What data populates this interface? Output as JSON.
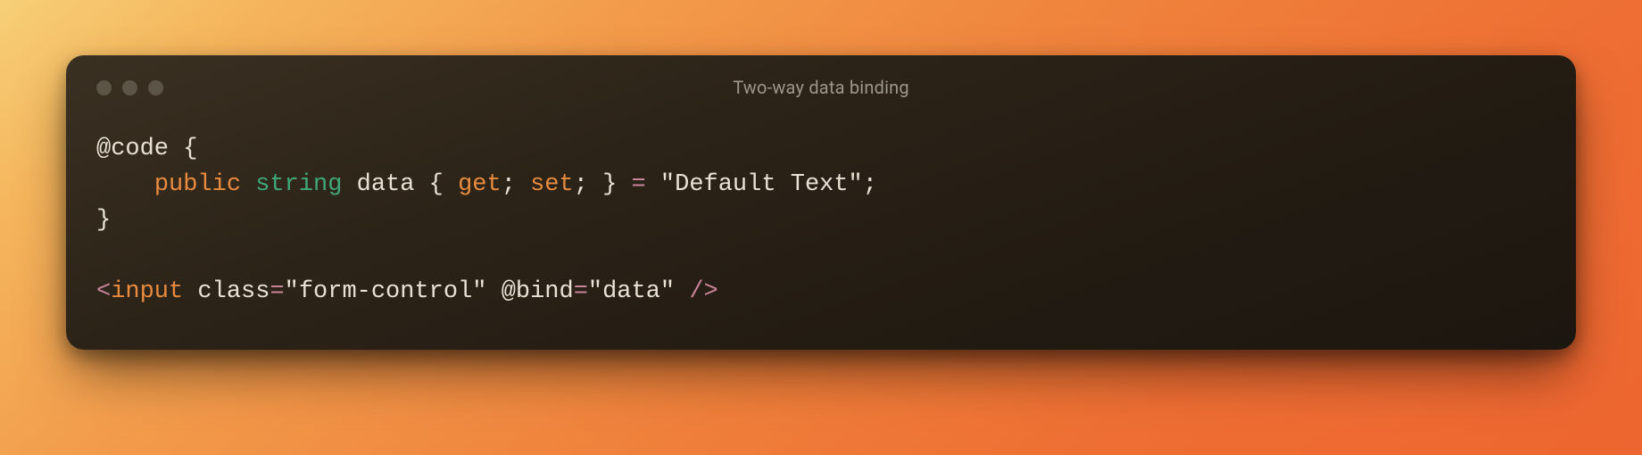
{
  "window": {
    "title": "Two-way data binding"
  },
  "code": {
    "line1": {
      "at_code": "@code",
      "brace_open": " {"
    },
    "line2": {
      "indent": "    ",
      "kw_public": "public",
      "sp1": " ",
      "type_string": "string",
      "sp2": " ",
      "ident_data": "data",
      "sp3": " ",
      "brace_open": "{",
      "sp4": " ",
      "get": "get",
      "semi1": ";",
      "sp5": " ",
      "set": "set",
      "semi2": ";",
      "sp6": " ",
      "brace_close": "}",
      "sp7": " ",
      "eq": "=",
      "sp8": " ",
      "str": "\"Default Text\"",
      "semi3": ";"
    },
    "line3": {
      "brace_close": "}"
    },
    "line5": {
      "lt": "<",
      "tag": "input",
      "sp1": " ",
      "attr_class": "class",
      "eq1": "=",
      "val_class": "\"form-control\"",
      "sp2": " ",
      "attr_bind": "@bind",
      "eq2": "=",
      "val_bind": "\"data\"",
      "sp3": " ",
      "slashgt": "/>"
    }
  }
}
